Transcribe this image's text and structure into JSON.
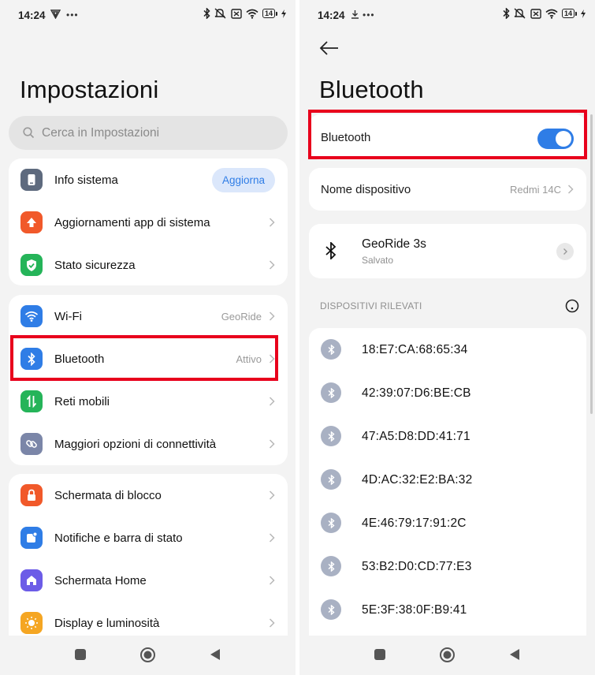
{
  "colors": {
    "accent": "#2f7de6",
    "highlight": "#e8001c",
    "background": "#f3f3f3",
    "card": "#ffffff"
  },
  "left": {
    "status": {
      "time": "14:24",
      "battery": "14"
    },
    "title": "Impostazioni",
    "search": {
      "placeholder": "Cerca in Impostazioni"
    },
    "group1": [
      {
        "label": "Info sistema",
        "icon": "phone-icon",
        "color": "#5e6a7e",
        "button": "Aggiorna"
      },
      {
        "label": "Aggiornamenti app di sistema",
        "icon": "arrow-up-icon",
        "color": "#f1592a"
      },
      {
        "label": "Stato sicurezza",
        "icon": "shield-check-icon",
        "color": "#25b459"
      }
    ],
    "group2": [
      {
        "label": "Wi-Fi",
        "icon": "wifi-icon",
        "color": "#2f7de6",
        "value": "GeoRide"
      },
      {
        "label": "Bluetooth",
        "icon": "bluetooth-icon",
        "color": "#2f7de6",
        "value": "Attivo"
      },
      {
        "label": "Reti mobili",
        "icon": "mobile-data-icon",
        "color": "#25b459"
      },
      {
        "label": "Maggiori opzioni di connettività",
        "icon": "link-icon",
        "color": "#7b86a8"
      }
    ],
    "group3": [
      {
        "label": "Schermata di blocco",
        "icon": "lock-icon",
        "color": "#f1592a"
      },
      {
        "label": "Notifiche e barra di stato",
        "icon": "notification-icon",
        "color": "#2f7de6"
      },
      {
        "label": "Schermata Home",
        "icon": "home-icon",
        "color": "#6c5ce7"
      },
      {
        "label": "Display e luminosità",
        "icon": "sun-icon",
        "color": "#f5a623"
      }
    ]
  },
  "right": {
    "status": {
      "time": "14:24",
      "battery": "14"
    },
    "title": "Bluetooth",
    "toggle": {
      "label": "Bluetooth",
      "state": "on"
    },
    "device_name": {
      "label": "Nome dispositivo",
      "value": "Redmi 14C"
    },
    "saved_device": {
      "name": "GeoRide 3s",
      "status": "Salvato"
    },
    "section_label": "DISPOSITIVI RILEVATI",
    "devices": [
      "18:E7:CA:68:65:34",
      "42:39:07:D6:BE:CB",
      "47:A5:D8:DD:41:71",
      "4D:AC:32:E2:BA:32",
      "4E:46:79:17:91:2C",
      "53:B2:D0:CD:77:E3",
      "5E:3F:38:0F:B9:41"
    ]
  }
}
